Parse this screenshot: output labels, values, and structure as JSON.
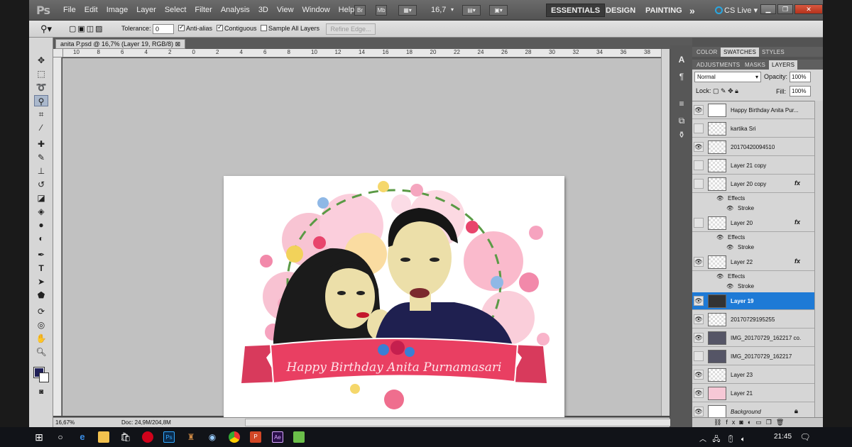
{
  "menubar": {
    "logo": "Ps",
    "items": [
      "File",
      "Edit",
      "Image",
      "Layer",
      "Select",
      "Filter",
      "Analysis",
      "3D",
      "View",
      "Window",
      "Help"
    ],
    "bridge_label": "Br",
    "minibridge_label": "Mb",
    "zoom": "16,7",
    "workspaces": [
      "ESSENTIALS",
      "DESIGN",
      "PAINTING"
    ],
    "more": "»",
    "cslive": "CS Live"
  },
  "options": {
    "tolerance_label": "Tolerance:",
    "tolerance_value": "0",
    "antialias": "Anti-alias",
    "contiguous": "Contiguous",
    "sample_all": "Sample All Layers",
    "refine_edge": "Refine Edge..."
  },
  "document": {
    "tab": "anita P.psd @ 16,7% (Layer 19, RGB/8)",
    "ruler_ticks": [
      "10",
      "8",
      "6",
      "4",
      "2",
      "0",
      "2",
      "4",
      "6",
      "8",
      "10",
      "12",
      "14",
      "16",
      "18",
      "20",
      "22",
      "24",
      "26",
      "28",
      "30",
      "32",
      "34",
      "36",
      "38"
    ],
    "status_zoom": "16,67%",
    "status_doc": "Doc: 24,9M/204,8M"
  },
  "artwork": {
    "banner_text": "Happy Birthday Anita Purnamasari",
    "colors": {
      "banner": "#e93f62",
      "hijab": "#1b1b1b",
      "jacket": "#1f2050",
      "skin": "#ecdfa9",
      "hair": "#161616"
    }
  },
  "panels": {
    "top_tabs": [
      "COLOR",
      "SWATCHES",
      "STYLES"
    ],
    "layer_tabs": [
      "ADJUSTMENTS",
      "MASKS",
      "LAYERS"
    ],
    "blend_mode": "Normal",
    "opacity_label": "Opacity:",
    "opacity": "100%",
    "lock_label": "Lock:",
    "fill_label": "Fill:",
    "fill": "100%"
  },
  "layers": [
    {
      "name": "Happy Birthday Anita Pur...",
      "visible": true,
      "fx": false
    },
    {
      "name": "kartika Sri",
      "visible": false,
      "fx": false
    },
    {
      "name": "20170420094510",
      "visible": true,
      "fx": false
    },
    {
      "name": "Layer 21 copy",
      "visible": false,
      "fx": false
    },
    {
      "name": "Layer 20 copy",
      "visible": false,
      "fx": true
    },
    {
      "name": "Layer 20",
      "visible": false,
      "fx": true
    },
    {
      "name": "Layer 22",
      "visible": true,
      "fx": true
    },
    {
      "name": "Layer 19",
      "visible": true,
      "fx": false,
      "selected": true
    },
    {
      "name": "20170729195255",
      "visible": true,
      "fx": false
    },
    {
      "name": "IMG_20170729_162217 co...",
      "visible": true,
      "fx": false
    },
    {
      "name": "IMG_20170729_162217",
      "visible": false,
      "fx": false
    },
    {
      "name": "Layer 23",
      "visible": true,
      "fx": false
    },
    {
      "name": "Layer 21",
      "visible": true,
      "fx": false
    },
    {
      "name": "Background",
      "visible": true,
      "fx": false
    }
  ],
  "effects": {
    "effects_label": "Effects",
    "stroke_label": "Stroke",
    "fx_label": "fx"
  },
  "taskbar": {
    "time": "21:45"
  }
}
